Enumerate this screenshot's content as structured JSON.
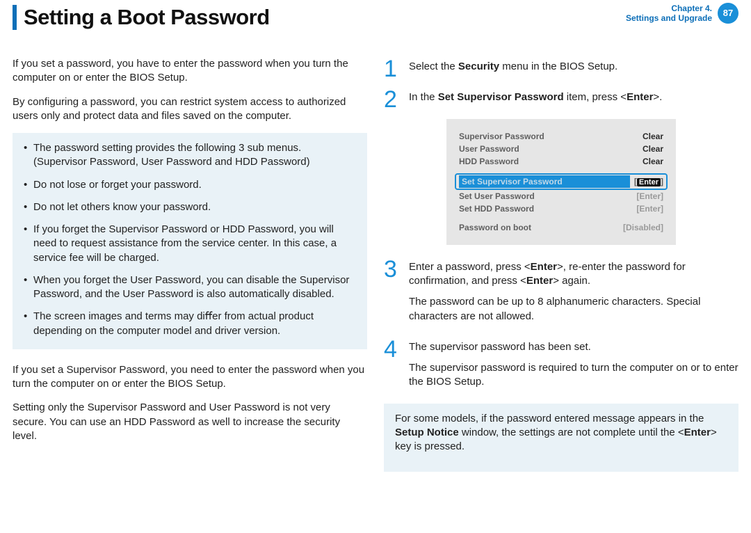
{
  "header": {
    "title": "Setting a Boot Password",
    "chapter_line1": "Chapter 4.",
    "chapter_line2": "Settings and Upgrade",
    "page_number": "87"
  },
  "left": {
    "p1": "If you set a password, you have to enter the password when you turn the computer on or enter the BIOS Setup.",
    "p2": "By conﬁguring a password, you can restrict system access to authorized users only and protect data and ﬁles saved on the computer.",
    "notes": [
      "The password setting provides the following 3 sub menus. (Supervisor Password, User Password and HDD Password)",
      "Do not lose or forget your password.",
      "Do not let others know your password.",
      "If you forget the Supervisor Password or HDD Password, you will need to request assistance from the service center. In this case, a service fee will be charged.",
      "When you forget the User Password, you can disable the Supervisor Password, and the User Password is also automatically disabled.",
      "The screen images and terms may diﬀer from actual product depending on the computer model and driver version."
    ],
    "p3": "If you set a Supervisor Password, you need to enter the password when you turn the computer on or enter the BIOS Setup.",
    "p4": "Setting only the Supervisor Password and User Password is not very secure. You can use an HDD Password as well to increase the security level."
  },
  "right": {
    "step1": {
      "num": "1",
      "text_a": "Select the ",
      "bold": "Security",
      "text_b": " menu in the BIOS Setup."
    },
    "step2": {
      "num": "2",
      "text_a": "In the ",
      "bold": "Set Supervisor Password",
      "text_b": " item, press <",
      "bold2": "Enter",
      "text_c": ">."
    },
    "bios": {
      "rows_top": [
        {
          "label": "Supervisor Password",
          "value": "Clear"
        },
        {
          "label": "User Password",
          "value": "Clear"
        },
        {
          "label": "HDD Password",
          "value": "Clear"
        }
      ],
      "highlight": {
        "label": "Set Supervisor Password",
        "value": "Enter"
      },
      "rows_mid": [
        {
          "label": "Set User Password",
          "value": "[Enter]"
        },
        {
          "label": "Set HDD Password",
          "value": "[Enter]"
        }
      ],
      "row_bottom": {
        "label": "Password on boot",
        "value": "[Disabled]"
      }
    },
    "step3": {
      "num": "3",
      "p1_a": "Enter a password, press <",
      "p1_b1": "Enter",
      "p1_c": ">, re-enter the password for conﬁrmation, and press <",
      "p1_b2": "Enter",
      "p1_d": "> again.",
      "p2": "The password can be up to 8 alphanumeric characters. Special characters are not allowed."
    },
    "step4": {
      "num": "4",
      "p1": "The supervisor password has been set.",
      "p2": "The supervisor password is required to turn the computer on or to enter the BIOS Setup."
    },
    "note2_a": "For some models, if the password entered message appears in the ",
    "note2_bold": "Setup Notice",
    "note2_b": " window, the settings are not complete until the <",
    "note2_bold2": "Enter",
    "note2_c": "> key is pressed."
  }
}
